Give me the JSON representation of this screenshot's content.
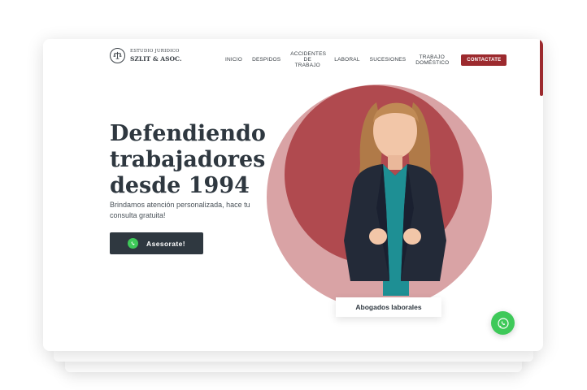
{
  "logo": {
    "subtitle": "ESTUDIO JURIDICO",
    "name": "SZLIT & ASOC."
  },
  "nav": {
    "items": [
      {
        "label": "INICIO"
      },
      {
        "label": "DESPIDOS"
      },
      {
        "label": "ACCIDENTES DE TRABAJO"
      },
      {
        "label": "LABORAL"
      },
      {
        "label": "SUCESIONES"
      },
      {
        "label": "TRABAJO DOMÉSTICO"
      }
    ],
    "cta_label": "CONTACTATE"
  },
  "hero": {
    "title_lines": [
      "Defendiendo",
      "trabajadores",
      "desde 1994"
    ],
    "subtitle": "Brindamos atención personalizada, hace tu consulta gratuita!",
    "button_label": "Asesorate!",
    "button_icon": "whatsapp-icon",
    "image_caption": "Abogados laborales"
  },
  "floating": {
    "icon": "whatsapp-icon"
  },
  "colors": {
    "brand_red": "#9c2a2e",
    "dark": "#2f3840",
    "circle_light": "#d9a3a5",
    "circle_dark": "#b04a4f",
    "whatsapp_green": "#3ec959"
  }
}
